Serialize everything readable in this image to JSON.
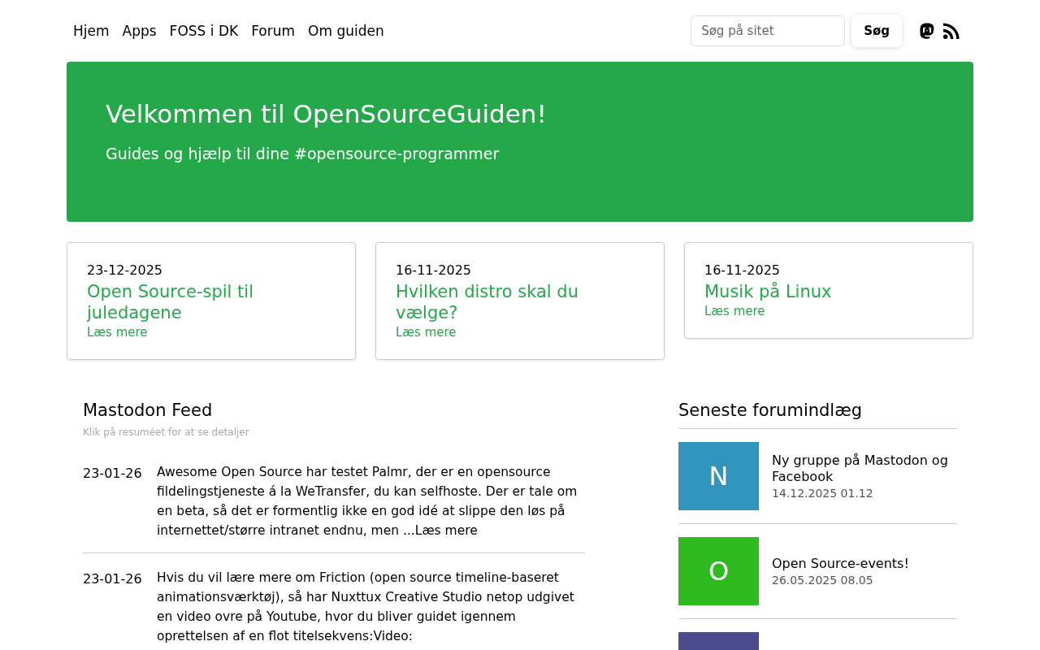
{
  "nav": {
    "links": [
      "Hjem",
      "Apps",
      "FOSS i DK",
      "Forum",
      "Om guiden"
    ]
  },
  "search": {
    "placeholder": "Søg på sitet",
    "button": "Søg"
  },
  "hero": {
    "title": "Velkommen til OpenSourceGuiden!",
    "subtitle": "Guides og hjælp til dine #opensource-programmer"
  },
  "articles": [
    {
      "date": "23-12-2025",
      "title": "Open Source-spil til juledagene",
      "link": "Læs mere"
    },
    {
      "date": "16-11-2025",
      "title": "Hvilken distro skal du vælge?",
      "link": "Læs mere"
    },
    {
      "date": "16-11-2025",
      "title": "Musik på Linux",
      "link": "Læs mere"
    }
  ],
  "mastodon_feed": {
    "title": "Mastodon Feed",
    "hint": "Klik på resuméet for at se detaljer",
    "posts": [
      {
        "date": "23-01-26",
        "text": "Awesome Open Source har testet Palmr, der er en opensource fildelingstjeneste á la WeTransfer, du kan selfhoste. Der er tale om en beta, så det er formentlig ikke en god idé at slippe den løs på internettet/større intranet endnu, men ...",
        "link": "Læs mere"
      },
      {
        "date": "23-01-26",
        "text": "Hvis du vil lære mere om Friction (open source timeline-baseret animationsværktøj), så har Nuxttux Creative Studio netop udgivet en video ovre på Youtube, hvor du bliver guidet igennem oprettelsen af en flot titelsekvens:Video:"
      }
    ]
  },
  "forum": {
    "title": "Seneste forumindlæg",
    "posts": [
      {
        "letter": "N",
        "color": "#3194bd",
        "title": "Ny gruppe på Mastodon og Facebook",
        "time": "14.12.2025 01.12"
      },
      {
        "letter": "O",
        "color": "#2fba20",
        "title": "Open Source-events!",
        "time": "26.05.2025 08.05"
      },
      {
        "color": "#4b4b8c"
      }
    ]
  }
}
